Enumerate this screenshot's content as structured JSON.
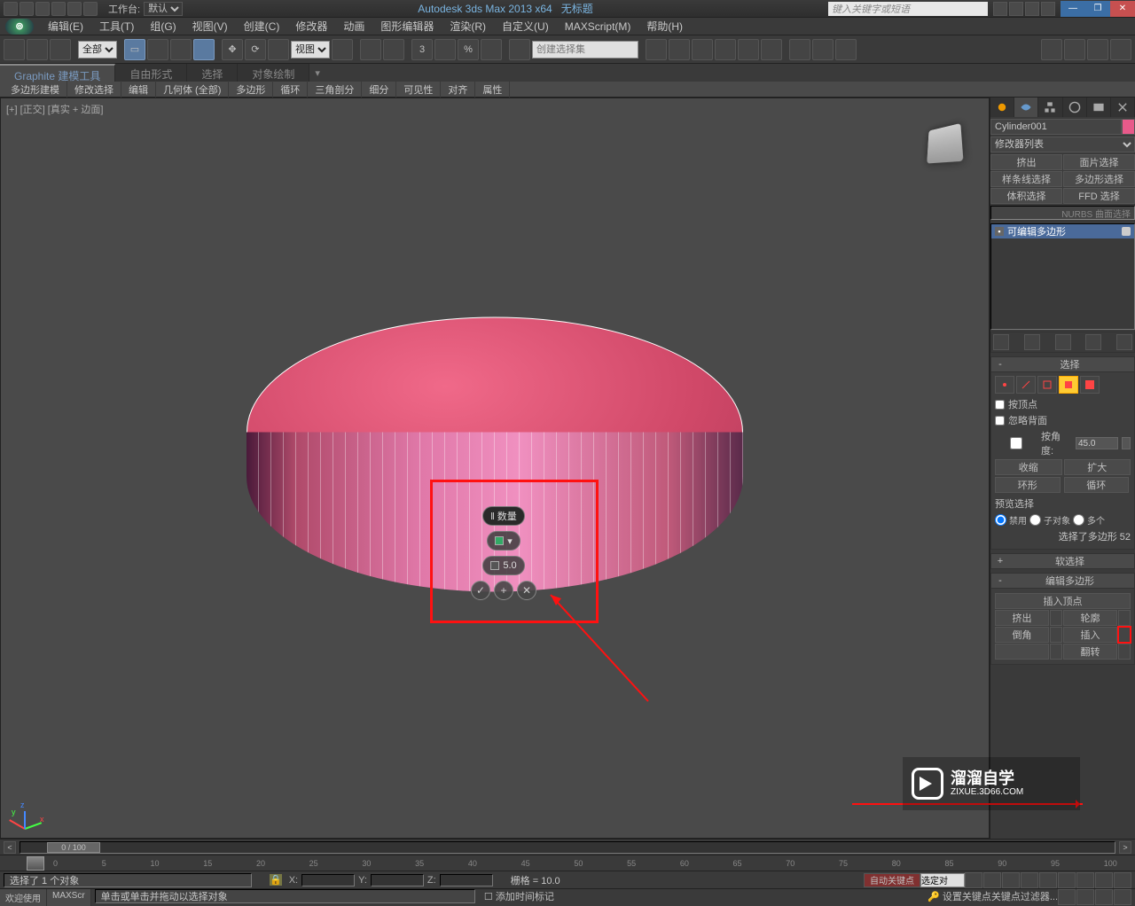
{
  "title": {
    "workspace_label": "工作台:",
    "workspace_value": "默认",
    "app": "Autodesk 3ds Max  2013 x64",
    "doc": "无标题",
    "search_placeholder": "键入关键字或短语"
  },
  "menus": [
    "编辑(E)",
    "工具(T)",
    "组(G)",
    "视图(V)",
    "创建(C)",
    "修改器",
    "动画",
    "图形编辑器",
    "渲染(R)",
    "自定义(U)",
    "MAXScript(M)",
    "帮助(H)"
  ],
  "toolbar": {
    "filter": "全部",
    "ref": "视图",
    "selset_placeholder": "创建选择集"
  },
  "ribbon": {
    "tabs": [
      "Graphite 建模工具",
      "自由形式",
      "选择",
      "对象绘制"
    ],
    "subtabs": [
      "多边形建模",
      "修改选择",
      "编辑",
      "几何体 (全部)",
      "多边形",
      "循环",
      "三角剖分",
      "细分",
      "可见性",
      "对齐",
      "属性"
    ]
  },
  "viewport": {
    "label": "[+] [正交] [真实 + 边面]"
  },
  "caddy": {
    "title": "‖ 数量",
    "value": "5.0"
  },
  "cmd": {
    "name": "Cylinder001",
    "modlist": "修改器列表",
    "sel_buttons": [
      "挤出",
      "面片选择",
      "样条线选择",
      "多边形选择",
      "体积选择",
      "FFD 选择"
    ],
    "nurbs": "NURBS 曲面选择",
    "stack_item": "可编辑多边形",
    "rollouts": {
      "selection": {
        "title": "选择",
        "by_vertex": "按顶点",
        "ignore_back": "忽略背面",
        "by_angle": "按角度:",
        "angle_val": "45.0",
        "shrink": "收缩",
        "grow": "扩大",
        "ring": "环形",
        "loop": "循环",
        "preview": "预览选择",
        "r_none": "禁用",
        "r_subobj": "子对象",
        "r_multi": "多个",
        "info": "选择了多边形 52"
      },
      "softsel": {
        "title": "软选择"
      },
      "editpoly": {
        "title": "编辑多边形",
        "insert_vertex": "插入顶点",
        "extrude": "挤出",
        "outline": "轮廓",
        "bevel": "倒角",
        "inset": "插入",
        "flip": "翻转"
      }
    }
  },
  "time": {
    "slider": "0 / 100",
    "ticks": [
      "0",
      "5",
      "10",
      "15",
      "20",
      "25",
      "30",
      "35",
      "40",
      "45",
      "50",
      "55",
      "60",
      "65",
      "70",
      "75",
      "80",
      "85",
      "90",
      "95",
      "100"
    ]
  },
  "status": {
    "line1": "选择了 1 个对象",
    "line2": "单击或单击并拖动以选择对象",
    "X": "X:",
    "Y": "Y:",
    "Z": "Z:",
    "grid": "栅格 = 10.0",
    "autokey": "自动关键点",
    "selset": "选定对",
    "setkey": "设置关键点",
    "keyfilter": "关键点过滤器...",
    "addtag": "添加时间标记",
    "welcome": "欢迎使用",
    "maxscript": "MAXScr"
  },
  "watermark": {
    "brand": "溜溜自学",
    "url": "ZIXUE.3D66.COM"
  }
}
